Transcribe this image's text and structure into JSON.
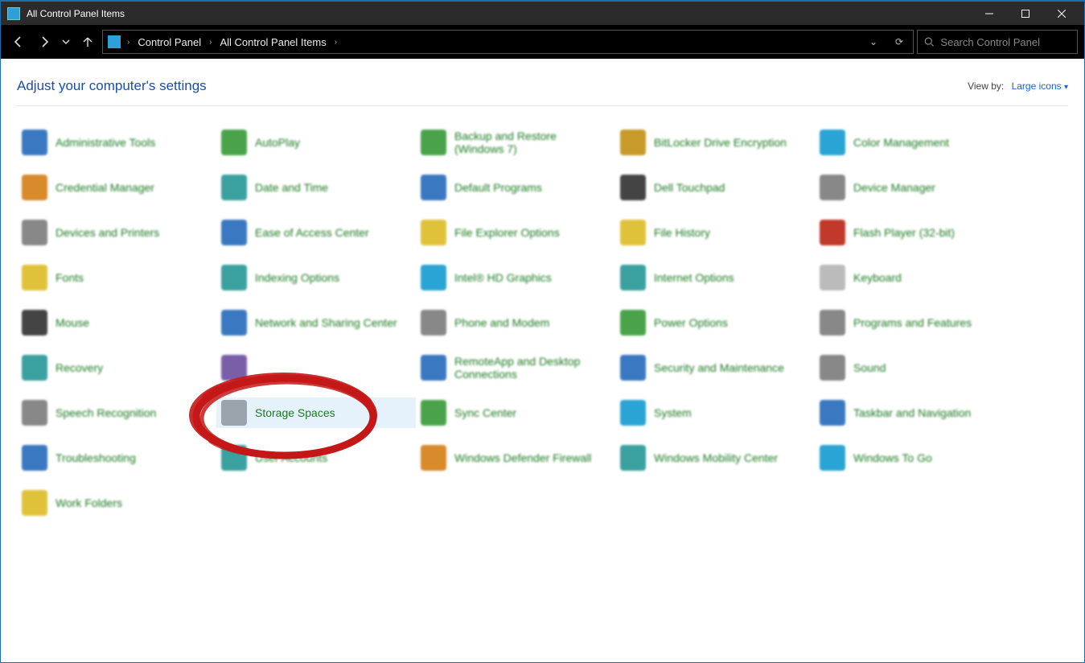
{
  "window": {
    "title": "All Control Panel Items"
  },
  "breadcrumb": {
    "root": "Control Panel",
    "current": "All Control Panel Items"
  },
  "search": {
    "placeholder": "Search Control Panel"
  },
  "header": {
    "title": "Adjust your computer's settings",
    "viewby_label": "View by:",
    "viewby_value": "Large icons"
  },
  "items": [
    {
      "label": "Administrative Tools",
      "ico": "c-blue"
    },
    {
      "label": "AutoPlay",
      "ico": "c-green"
    },
    {
      "label": "Backup and Restore (Windows 7)",
      "ico": "c-green"
    },
    {
      "label": "BitLocker Drive Encryption",
      "ico": "c-gold"
    },
    {
      "label": "Color Management",
      "ico": "c-cyan"
    },
    {
      "label": "Credential Manager",
      "ico": "c-orange"
    },
    {
      "label": "Date and Time",
      "ico": "c-teal"
    },
    {
      "label": "Default Programs",
      "ico": "c-blue"
    },
    {
      "label": "Dell Touchpad",
      "ico": "c-dark"
    },
    {
      "label": "Device Manager",
      "ico": "c-gray"
    },
    {
      "label": "Devices and Printers",
      "ico": "c-gray"
    },
    {
      "label": "Ease of Access Center",
      "ico": "c-blue"
    },
    {
      "label": "File Explorer Options",
      "ico": "c-yellow"
    },
    {
      "label": "File History",
      "ico": "c-yellow"
    },
    {
      "label": "Flash Player (32-bit)",
      "ico": "c-red"
    },
    {
      "label": "Fonts",
      "ico": "c-yellow"
    },
    {
      "label": "Indexing Options",
      "ico": "c-teal"
    },
    {
      "label": "Intel® HD Graphics",
      "ico": "c-cyan"
    },
    {
      "label": "Internet Options",
      "ico": "c-teal"
    },
    {
      "label": "Keyboard",
      "ico": "c-white"
    },
    {
      "label": "Mouse",
      "ico": "c-dark"
    },
    {
      "label": "Network and Sharing Center",
      "ico": "c-blue"
    },
    {
      "label": "Phone and Modem",
      "ico": "c-gray"
    },
    {
      "label": "Power Options",
      "ico": "c-green"
    },
    {
      "label": "Programs and Features",
      "ico": "c-gray"
    },
    {
      "label": "Recovery",
      "ico": "c-teal"
    },
    {
      "label": "",
      "ico": "c-purple"
    },
    {
      "label": "RemoteApp and Desktop Connections",
      "ico": "c-blue"
    },
    {
      "label": "Security and Maintenance",
      "ico": "c-blue"
    },
    {
      "label": "Sound",
      "ico": "c-gray"
    },
    {
      "label": "Speech Recognition",
      "ico": "c-gray"
    },
    {
      "label": "Storage Spaces",
      "ico": "c-db",
      "selected": true
    },
    {
      "label": "Sync Center",
      "ico": "c-green"
    },
    {
      "label": "System",
      "ico": "c-cyan"
    },
    {
      "label": "Taskbar and Navigation",
      "ico": "c-blue"
    },
    {
      "label": "Troubleshooting",
      "ico": "c-blue"
    },
    {
      "label": "User Accounts",
      "ico": "c-teal"
    },
    {
      "label": "Windows Defender Firewall",
      "ico": "c-orange"
    },
    {
      "label": "Windows Mobility Center",
      "ico": "c-teal"
    },
    {
      "label": "Windows To Go",
      "ico": "c-cyan"
    },
    {
      "label": "Work Folders",
      "ico": "c-yellow"
    }
  ]
}
